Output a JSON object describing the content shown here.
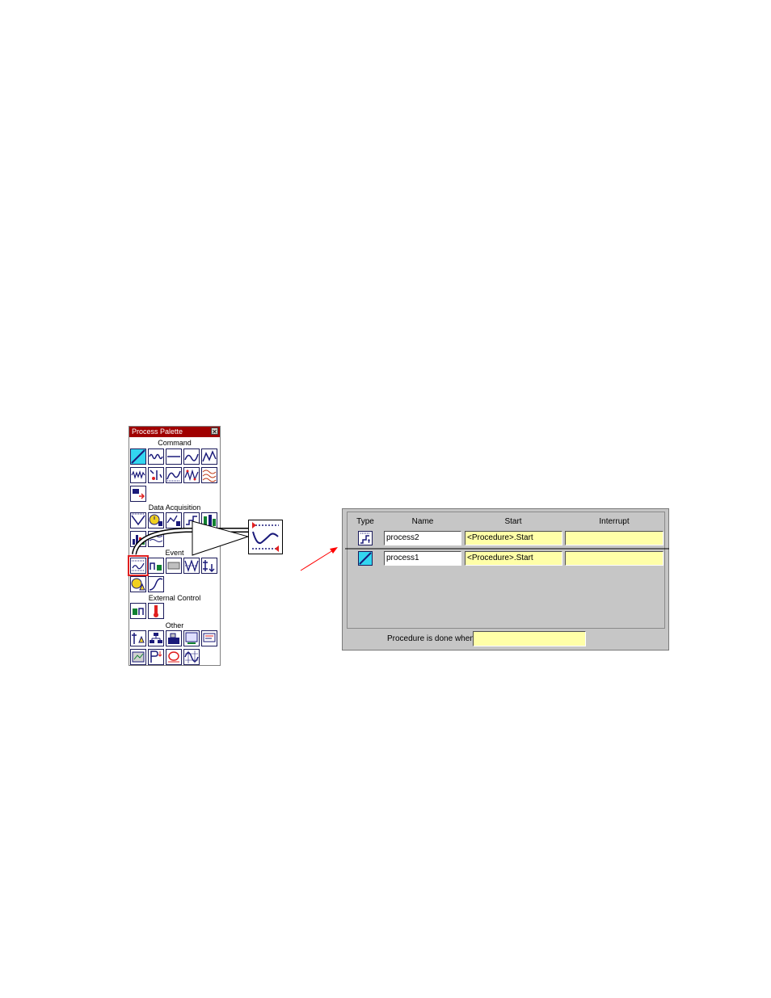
{
  "palette": {
    "title": "Process Palette",
    "close_glyph": "✕",
    "sections": {
      "command": "Command",
      "data_acquisition": "Data Acquisition",
      "event": "Event",
      "external_control": "External Control",
      "other": "Other"
    }
  },
  "editor": {
    "columns": {
      "type": "Type",
      "name": "Name",
      "start": "Start",
      "interrupt": "Interrupt"
    },
    "rows": [
      {
        "type_icon": "step-process-icon",
        "name": "process2",
        "start": "<Procedure>.Start",
        "interrupt": ""
      },
      {
        "type_icon": "ramp-process-icon",
        "name": "process1",
        "start": "<Procedure>.Start",
        "interrupt": ""
      }
    ],
    "done_label": "Procedure is done when",
    "done_value": ""
  },
  "colors": {
    "palette_title_bg": "#a00000",
    "icon_accent": "#33d6f0",
    "selection": "#e02020",
    "field_yellow": "#ffffa8",
    "editor_bg": "#c6c6c6"
  }
}
